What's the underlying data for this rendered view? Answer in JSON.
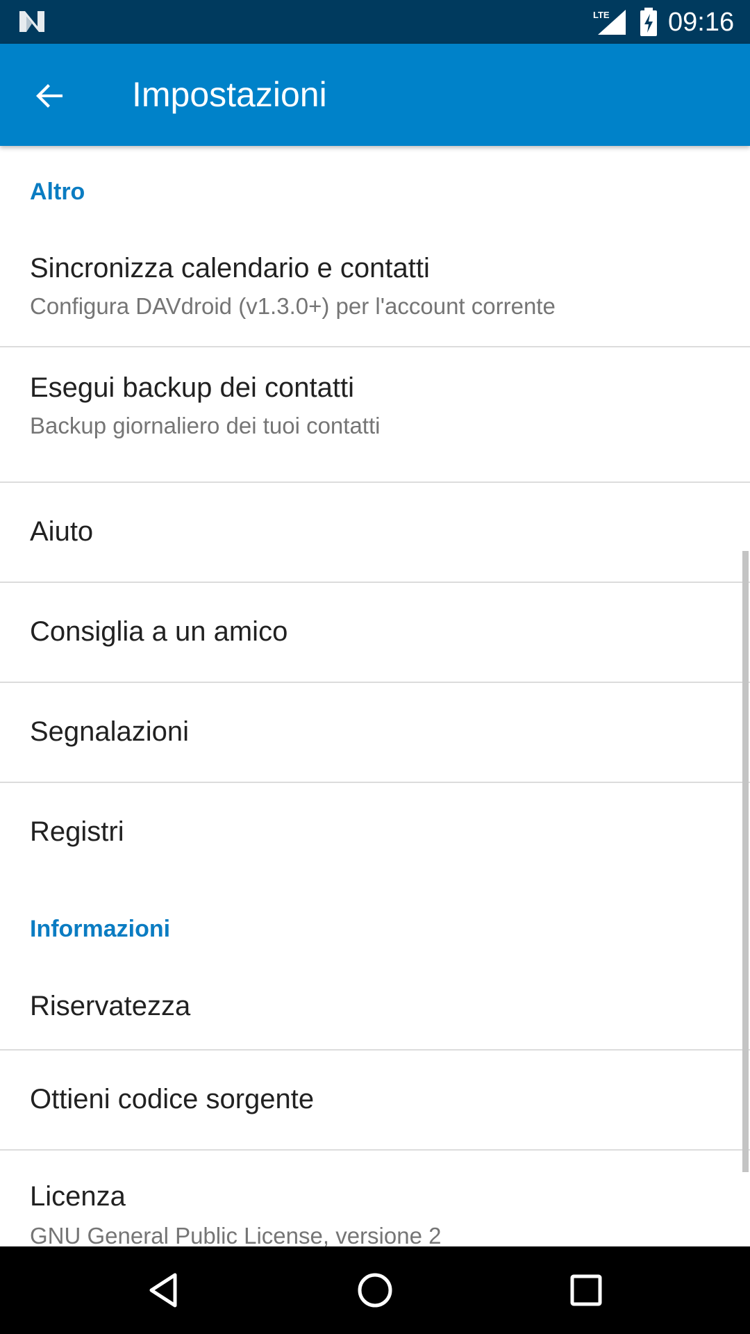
{
  "status_bar": {
    "network": "LTE",
    "time": "09:16"
  },
  "app_bar": {
    "title": "Impostazioni",
    "back_icon": "arrow-back-icon"
  },
  "sections": [
    {
      "header": "Altro",
      "items": [
        {
          "title": "Sincronizza calendario e contatti",
          "summary": "Configura DAVdroid (v1.3.0+) per l'account corrente"
        },
        {
          "title": "Esegui backup dei contatti",
          "summary": "Backup giornaliero dei tuoi contatti"
        },
        {
          "title": "Aiuto"
        },
        {
          "title": "Consiglia a un amico"
        },
        {
          "title": "Segnalazioni"
        },
        {
          "title": "Registri"
        }
      ]
    },
    {
      "header": "Informazioni",
      "items": [
        {
          "title": "Riservatezza"
        },
        {
          "title": "Ottieni codice sorgente"
        },
        {
          "title": "Licenza",
          "summary": "GNU General Public License, versione 2"
        }
      ]
    }
  ],
  "nav_bar": {
    "back_icon": "triangle-back-icon",
    "home_icon": "circle-home-icon",
    "recents_icon": "square-recents-icon"
  },
  "colors": {
    "status_bar": "#003a5e",
    "app_bar": "#0082c9",
    "section_header": "#0a7cc2",
    "divider": "#dcdcdc"
  }
}
